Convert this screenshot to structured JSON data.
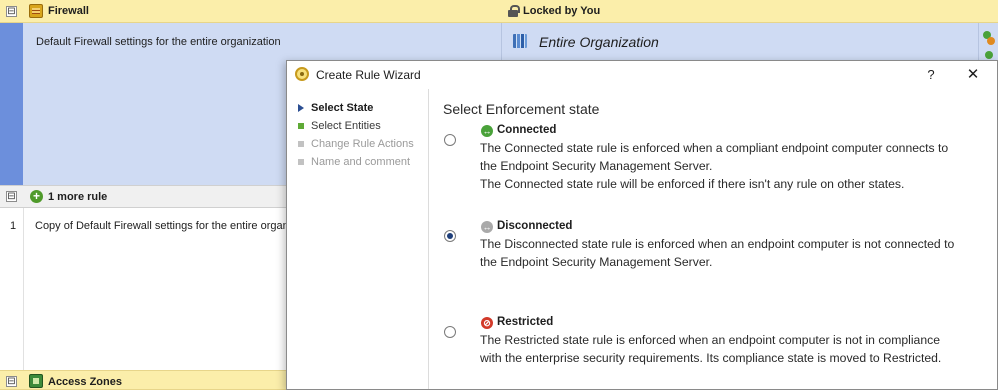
{
  "grid": {
    "firewall_header": {
      "title": "Firewall",
      "lock_status": "Locked by You",
      "expander": "⊟"
    },
    "rule_row": {
      "description": "Default Firewall settings for the entire organization",
      "applies_to": "Entire Organization"
    },
    "more_rules_header": {
      "title": "1 more rule",
      "expander": "⊟"
    },
    "rule1_row": {
      "number": "1",
      "description": "Copy of Default Firewall settings for the entire organization"
    },
    "access_zones_header": {
      "title": "Access Zones",
      "expander": "⊟"
    }
  },
  "dialog": {
    "title": "Create Rule Wizard",
    "help_label": "?",
    "close_label": "✕",
    "steps": [
      {
        "label": "Select State",
        "state": "current"
      },
      {
        "label": "Select Entities",
        "state": "pending"
      },
      {
        "label": "Change Rule Actions",
        "state": "disabled"
      },
      {
        "label": "Name and comment",
        "state": "disabled"
      }
    ],
    "content_title": "Select Enforcement state",
    "options": [
      {
        "title": "Connected",
        "selected": false,
        "icon": "connected-icon",
        "icon_color": "#4aa23a",
        "desc1": "The Connected state rule is enforced when a compliant endpoint computer connects to",
        "desc2": "the Endpoint Security Management Server.",
        "desc3": "The Connected state rule will be enforced if there isn't any rule on other states."
      },
      {
        "title": "Disconnected",
        "selected": true,
        "icon": "disconnected-icon",
        "icon_color": "#a9a9a9",
        "desc1": "The Disconnected state rule is enforced when an endpoint computer is not connected to",
        "desc2": "the Endpoint Security Management Server."
      },
      {
        "title": "Restricted",
        "selected": false,
        "icon": "restricted-icon",
        "icon_color": "#d23a2a",
        "desc1": "The Restricted state rule is enforced when an endpoint computer is not in compliance",
        "desc2": "with the enterprise security requirements. Its compliance state is moved to Restricted."
      }
    ]
  },
  "colors": {
    "header_yellow": "#fbeeaa",
    "selected_row": "#cfdbf3",
    "selected_stripe": "#6c8fdc"
  }
}
